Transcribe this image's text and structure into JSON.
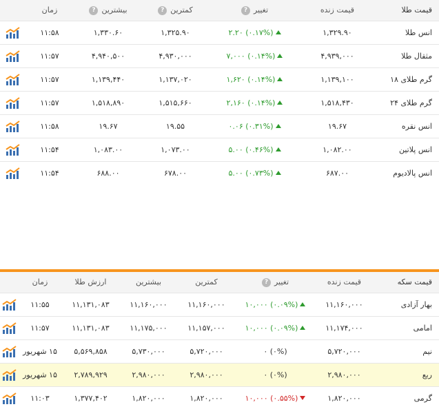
{
  "gold_table": {
    "headers": {
      "name": "قیمت طلا",
      "live": "قیمت زنده",
      "change": "تغییر",
      "low": "کمترین",
      "high": "بیشترین",
      "time": "زمان"
    },
    "rows": [
      {
        "name": "انس طلا",
        "live": "۱,۳۲۹.۹۰",
        "change": "۲.۲۰",
        "pct": "(۰.۱۷%)",
        "dir": "up",
        "low": "۱,۳۲۵.۹۰",
        "high": "۱,۳۳۰.۶۰",
        "time": "۱۱:۵۸"
      },
      {
        "name": "مثقال طلا",
        "live": "۴,۹۳۹,۰۰۰",
        "change": "۷,۰۰۰",
        "pct": "(۰.۱۴%)",
        "dir": "up",
        "low": "۴,۹۳۰,۰۰۰",
        "high": "۴,۹۴۰,۵۰۰",
        "time": "۱۱:۵۷"
      },
      {
        "name": "گرم طلای ۱۸",
        "live": "۱,۱۳۹,۱۰۰",
        "change": "۱,۶۲۰",
        "pct": "(۰.۱۴%)",
        "dir": "up",
        "low": "۱,۱۳۷,۰۲۰",
        "high": "۱,۱۳۹,۴۴۰",
        "time": "۱۱:۵۷"
      },
      {
        "name": "گرم طلای ۲۴",
        "live": "۱,۵۱۸,۴۳۰",
        "change": "۲,۱۶۰",
        "pct": "(۰.۱۴%)",
        "dir": "up",
        "low": "۱,۵۱۵,۶۶۰",
        "high": "۱,۵۱۸,۸۹۰",
        "time": "۱۱:۵۷"
      },
      {
        "name": "انس نقره",
        "live": "۱۹.۶۷",
        "change": "۰.۰۶",
        "pct": "(۰.۳۱%)",
        "dir": "up",
        "low": "۱۹.۵۵",
        "high": "۱۹.۶۷",
        "time": "۱۱:۵۸"
      },
      {
        "name": "انس پلاتین",
        "live": "۱,۰۸۲.۰۰",
        "change": "۵.۰۰",
        "pct": "(۰.۴۶%)",
        "dir": "up",
        "low": "۱,۰۷۳.۰۰",
        "high": "۱,۰۸۳.۰۰",
        "time": "۱۱:۵۴"
      },
      {
        "name": "انس پالادیوم",
        "live": "۶۸۷.۰۰",
        "change": "۵.۰۰",
        "pct": "(۰.۷۳%)",
        "dir": "up",
        "low": "۶۷۸.۰۰",
        "high": "۶۸۸.۰۰",
        "time": "۱۱:۵۴"
      }
    ]
  },
  "coin_table": {
    "headers": {
      "name": "قیمت سکه",
      "live": "قیمت زنده",
      "change": "تغییر",
      "low": "کمترین",
      "high": "بیشترین",
      "gold_value": "ارزش طلا",
      "time": "زمان"
    },
    "rows": [
      {
        "name": "بهار آزادی",
        "live": "۱۱,۱۶۰,۰۰۰",
        "change": "۱۰,۰۰۰",
        "pct": "(۰.۰۹%)",
        "dir": "up",
        "low": "۱۱,۱۶۰,۰۰۰",
        "high": "۱۱,۱۶۰,۰۰۰",
        "gold_value": "۱۱,۱۳۱,۰۸۳",
        "time": "۱۱:۵۵",
        "highlight": false
      },
      {
        "name": "امامی",
        "live": "۱۱,۱۷۴,۰۰۰",
        "change": "۱۰,۰۰۰",
        "pct": "(۰.۰۹%)",
        "dir": "up",
        "low": "۱۱,۱۵۷,۰۰۰",
        "high": "۱۱,۱۷۵,۰۰۰",
        "gold_value": "۱۱,۱۳۱,۰۸۳",
        "time": "۱۱:۵۷",
        "highlight": false
      },
      {
        "name": "نیم",
        "live": "۵,۷۲۰,۰۰۰",
        "change": "۰",
        "pct": "(۰%)",
        "dir": "none",
        "low": "۵,۷۲۰,۰۰۰",
        "high": "۵,۷۳۰,۰۰۰",
        "gold_value": "۵,۵۶۹,۸۵۸",
        "time": "۱۵ شهریور",
        "highlight": false
      },
      {
        "name": "ربع",
        "live": "۲,۹۸۰,۰۰۰",
        "change": "۰",
        "pct": "(۰%)",
        "dir": "none",
        "low": "۲,۹۸۰,۰۰۰",
        "high": "۲,۹۸۰,۰۰۰",
        "gold_value": "۲,۷۸۹,۹۲۹",
        "time": "۱۵ شهریور",
        "highlight": true
      },
      {
        "name": "گرمی",
        "live": "۱,۸۲۰,۰۰۰",
        "change": "۱۰,۰۰۰",
        "pct": "(۰.۵۵%)",
        "dir": "down",
        "low": "۱,۸۲۰,۰۰۰",
        "high": "۱,۸۲۰,۰۰۰",
        "gold_value": "۱,۳۷۷,۴۰۲",
        "time": "۱۱:۰۳",
        "highlight": false
      }
    ]
  },
  "help_glyph": "?",
  "colors": {
    "up": "#2e9b2e",
    "down": "#d22727",
    "accent": "#f7941d",
    "highlight": "#fdfbd6"
  }
}
